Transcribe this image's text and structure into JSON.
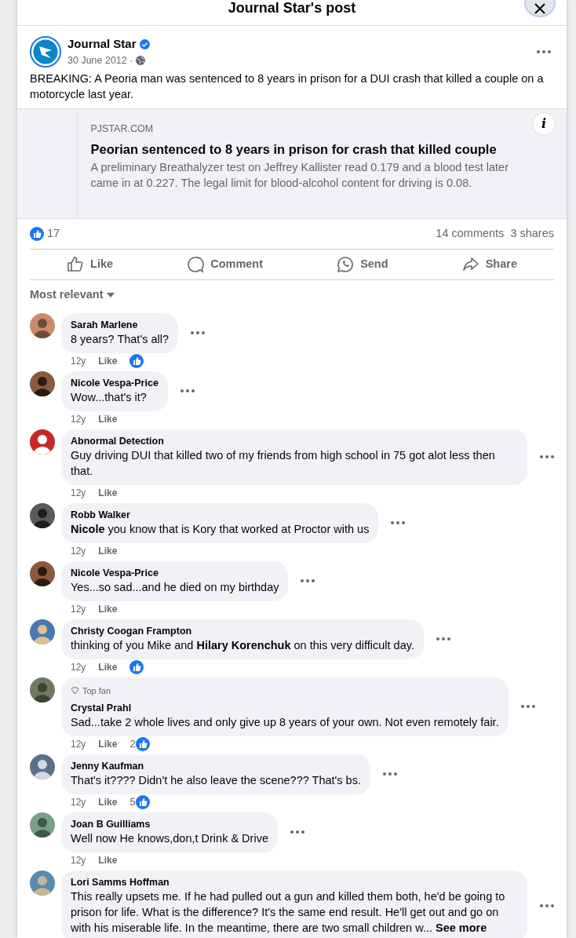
{
  "dialog": {
    "title": "Journal Star's post"
  },
  "post": {
    "author": "Journal Star",
    "verified": true,
    "date": "30 June 2012 ·",
    "text": "BREAKING: A Peoria man was sentenced to 8 years in prison for a DUI crash that killed a couple on a motorcycle last year.",
    "link": {
      "domain": "PJSTAR.COM",
      "headline": "Peorian sentenced to 8 years in prison for crash that killed couple",
      "description": "A preliminary Breathalyzer test on Jeffrey Kallister read 0.179 and a blood test later came in at 0.227. The legal limit for blood-alcohol content for driving is 0.08.",
      "info": "i"
    },
    "reaction_count": "17",
    "comments_count": "14 comments",
    "shares_count": "3 shares",
    "actions": [
      {
        "kind": "like",
        "label": "Like"
      },
      {
        "kind": "comment",
        "label": "Comment"
      },
      {
        "kind": "send",
        "label": "Send"
      },
      {
        "kind": "share",
        "label": "Share"
      }
    ]
  },
  "sort": {
    "label": "Most relevant"
  },
  "comments": [
    {
      "name": "Sarah Marlene",
      "text": "8 years? That's all?",
      "time": "12y",
      "like": "Like",
      "reacted": true
    },
    {
      "name": "Nicole Vespa-Price",
      "text": "Wow...that's it?",
      "time": "12y",
      "like": "Like",
      "reacted": false
    },
    {
      "name": "Abnormal Detection",
      "text": "Guy driving DUI that killed two of my friends from high school in 75 got alot less then that.",
      "time": "12y",
      "like": "Like",
      "reacted": false
    },
    {
      "name": "Robb Walker",
      "text": "**Nicole** you know that is Kory that worked at Proctor with us",
      "time": "12y",
      "like": "Like",
      "reacted": false
    },
    {
      "name": "Nicole Vespa-Price",
      "text": "Yes...so sad...and he died on my birthday",
      "time": "12y",
      "like": "Like",
      "reacted": false
    },
    {
      "name": "Christy Coogan Frampton",
      "text": "thinking of you Mike and **Hilary Korenchuk** on this very difficult day.",
      "time": "12y",
      "like": "Like",
      "reacted": true
    },
    {
      "badge": "Top fan",
      "name": "Crystal Prahl",
      "text": "Sad...take 2 whole lives and only give up 8 years of your own. Not even remotely fair.",
      "time": "12y",
      "like": "Like",
      "reacted": true,
      "reaction_count": "2"
    },
    {
      "name": "Jenny Kaufman",
      "text": "That's it???? Didn't he also leave the scene??? That's bs.",
      "time": "12y",
      "like": "Like",
      "reacted": true,
      "reaction_count": "5"
    },
    {
      "name": "Joan B Guilliams",
      "text": "Well now He knows,don,t Drink & Drive",
      "time": "12y",
      "like": "Like",
      "reacted": false
    },
    {
      "name": "Lori Samms Hoffman",
      "text": "This really upsets me. If he had pulled out a gun and killed them both, he'd be going to prison for life. What is the difference? It's the same end result. He'll get out and go on with his miserable life. In the meantime, there are two small children w...",
      "see_more": "See more"
    }
  ]
}
